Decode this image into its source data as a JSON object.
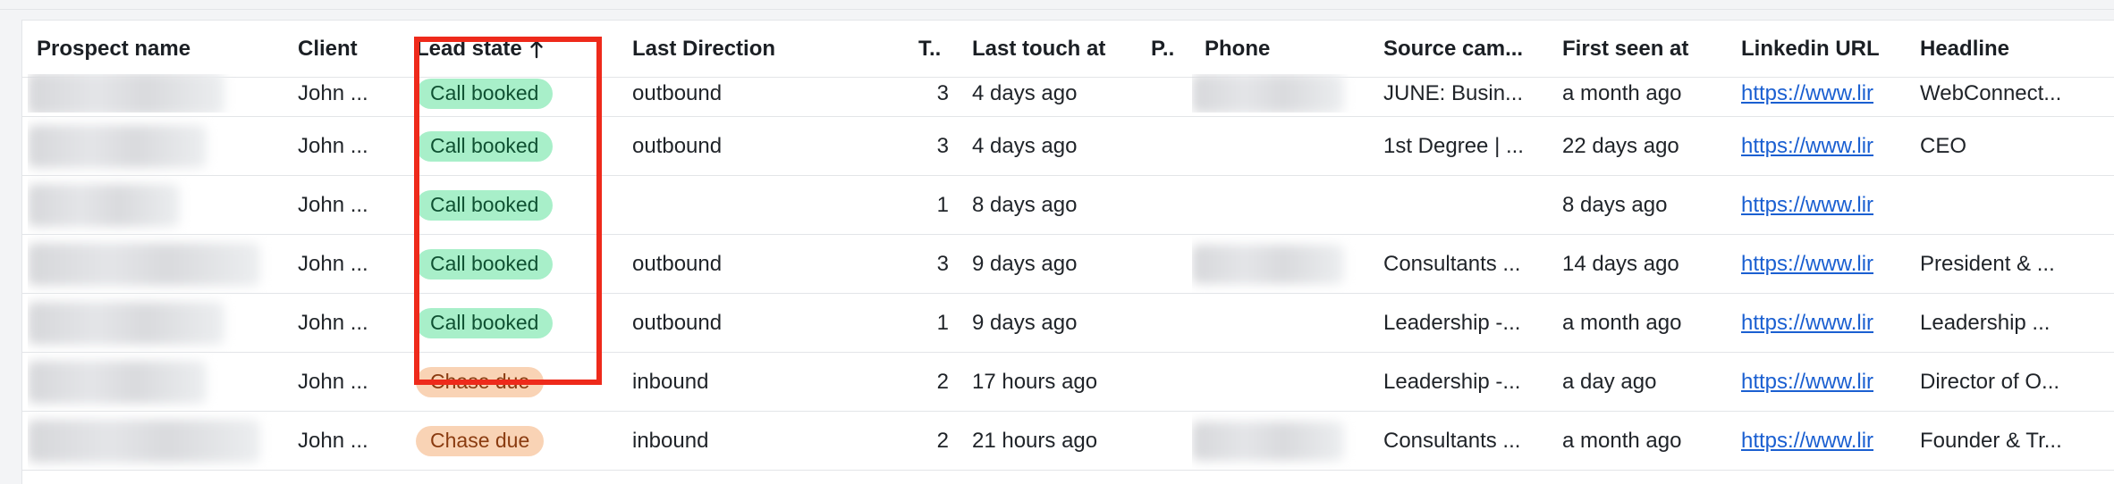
{
  "table": {
    "columns": [
      {
        "key": "prospect",
        "label": "Prospect name"
      },
      {
        "key": "client",
        "label": "Client"
      },
      {
        "key": "lead_state",
        "label": "Lead state",
        "sort": "ascending",
        "sort_icon": "arrow-up-icon"
      },
      {
        "key": "last_direction",
        "label": "Last Direction"
      },
      {
        "key": "t",
        "label": "T.."
      },
      {
        "key": "last_touch",
        "label": "Last touch at"
      },
      {
        "key": "p",
        "label": "P.."
      },
      {
        "key": "phone",
        "label": "Phone"
      },
      {
        "key": "source",
        "label": "Source cam..."
      },
      {
        "key": "first_seen",
        "label": "First seen at"
      },
      {
        "key": "linkedin",
        "label": "Linkedin URL"
      },
      {
        "key": "headline",
        "label": "Headline"
      }
    ],
    "rows": [
      {
        "client": "John ...",
        "lead_state": "Call booked",
        "state_kind": "booked",
        "last_direction": "outbound",
        "t": "3",
        "last_touch": "4 days ago",
        "phone_redacted": true,
        "source": "JUNE: Busin...",
        "first_seen": "a month ago",
        "linkedin": "https://www.lir",
        "headline": "WebConnect..."
      },
      {
        "client": "John ...",
        "lead_state": "Call booked",
        "state_kind": "booked",
        "last_direction": "outbound",
        "t": "3",
        "last_touch": "4 days ago",
        "phone_redacted": false,
        "source": "1st Degree | ...",
        "first_seen": "22 days ago",
        "linkedin": "https://www.lir",
        "headline": "CEO"
      },
      {
        "client": "John ...",
        "lead_state": "Call booked",
        "state_kind": "booked",
        "last_direction": "",
        "t": "1",
        "last_touch": "8 days ago",
        "phone_redacted": false,
        "source": "",
        "first_seen": "8 days ago",
        "linkedin": "https://www.lir",
        "headline": ""
      },
      {
        "client": "John ...",
        "lead_state": "Call booked",
        "state_kind": "booked",
        "last_direction": "outbound",
        "t": "3",
        "last_touch": "9 days ago",
        "phone_redacted": true,
        "source": "Consultants ...",
        "first_seen": "14 days ago",
        "linkedin": "https://www.lir",
        "headline": "President & ..."
      },
      {
        "client": "John ...",
        "lead_state": "Call booked",
        "state_kind": "booked",
        "last_direction": "outbound",
        "t": "1",
        "last_touch": "9 days ago",
        "phone_redacted": false,
        "source": "Leadership -...",
        "first_seen": "a month ago",
        "linkedin": "https://www.lir",
        "headline": "Leadership ..."
      },
      {
        "client": "John ...",
        "lead_state": "Chase due",
        "state_kind": "chase",
        "last_direction": "inbound",
        "t": "2",
        "last_touch": "17 hours ago",
        "phone_redacted": false,
        "source": "Leadership -...",
        "first_seen": "a day ago",
        "linkedin": "https://www.lir",
        "headline": "Director of O..."
      },
      {
        "client": "John ...",
        "lead_state": "Chase due",
        "state_kind": "chase",
        "last_direction": "inbound",
        "t": "2",
        "last_touch": "21 hours ago",
        "phone_redacted": true,
        "source": "Consultants ...",
        "first_seen": "a month ago",
        "linkedin": "https://www.lir",
        "headline": "Founder & Tr..."
      }
    ]
  },
  "colors": {
    "booked_bg": "#a8efc9",
    "booked_text": "#0f5132",
    "chase_bg": "#f9d3b5",
    "chase_text": "#8a3b10",
    "highlight": "#ee2a1b",
    "link": "#1a5fd1"
  }
}
